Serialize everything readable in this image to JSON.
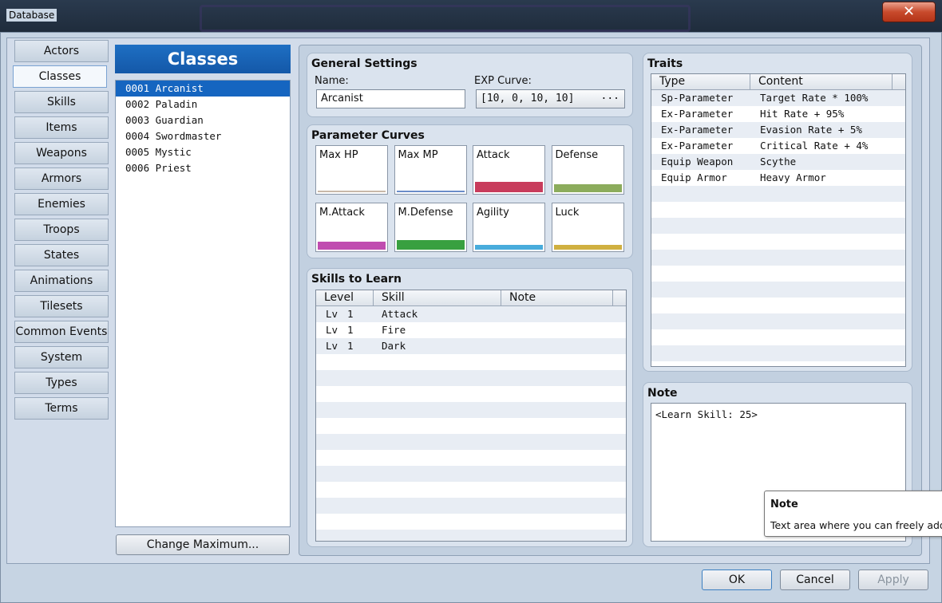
{
  "window": {
    "title": "Database",
    "close_glyph": "✕"
  },
  "tabs": [
    "Actors",
    "Classes",
    "Skills",
    "Items",
    "Weapons",
    "Armors",
    "Enemies",
    "Troops",
    "States",
    "Animations",
    "Tilesets",
    "Common Events",
    "System",
    "Types",
    "Terms"
  ],
  "classes": {
    "title": "Classes",
    "items": [
      "0001 Arcanist",
      "0002 Paladin",
      "0003 Guardian",
      "0004 Swordmaster",
      "0005 Mystic",
      "0006 Priest"
    ],
    "change_max": "Change Maximum..."
  },
  "general": {
    "title": "General Settings",
    "name_label": "Name:",
    "name_value": "Arcanist",
    "exp_label": "EXP Curve:",
    "exp_value": "[10, 0, 10, 10]",
    "exp_btn": "..."
  },
  "params": {
    "title": "Parameter Curves",
    "curves": [
      {
        "label": "Max HP",
        "color": "#c8b8a8",
        "level": 0.02
      },
      {
        "label": "Max MP",
        "color": "#6a8cc8",
        "level": 0.02
      },
      {
        "label": "Attack",
        "color": "#c83c5c",
        "level": 0.22
      },
      {
        "label": "Defense",
        "color": "#8cac5c",
        "level": 0.18
      },
      {
        "label": "M.Attack",
        "color": "#c04cb0",
        "level": 0.18
      },
      {
        "label": "M.Defense",
        "color": "#38a040",
        "level": 0.2
      },
      {
        "label": "Agility",
        "color": "#48acdc",
        "level": 0.1
      },
      {
        "label": "Luck",
        "color": "#d0b040",
        "level": 0.1
      }
    ]
  },
  "skills": {
    "title": "Skills to Learn",
    "headers": [
      "Level",
      "Skill",
      "Note"
    ],
    "rows": [
      {
        "lv": "Lv",
        "level": "1",
        "skill": "Attack",
        "note": ""
      },
      {
        "lv": "Lv",
        "level": "1",
        "skill": "Fire",
        "note": ""
      },
      {
        "lv": "Lv",
        "level": "1",
        "skill": "Dark",
        "note": ""
      }
    ]
  },
  "traits": {
    "title": "Traits",
    "headers": [
      "Type",
      "Content"
    ],
    "rows": [
      {
        "type": "Sp-Parameter",
        "content": "Target Rate * 100%"
      },
      {
        "type": "Ex-Parameter",
        "content": "Hit Rate + 95%"
      },
      {
        "type": "Ex-Parameter",
        "content": "Evasion Rate + 5%"
      },
      {
        "type": "Ex-Parameter",
        "content": "Critical Rate + 4%"
      },
      {
        "type": "Equip Weapon",
        "content": "Scythe"
      },
      {
        "type": "Equip Armor",
        "content": "Heavy Armor"
      }
    ]
  },
  "note": {
    "title": "Note",
    "value": "<Learn Skill: 25>"
  },
  "tooltip": {
    "title": "Note",
    "text": "Text area where you can freely add n"
  },
  "footer": {
    "ok": "OK",
    "cancel": "Cancel",
    "apply": "Apply"
  }
}
